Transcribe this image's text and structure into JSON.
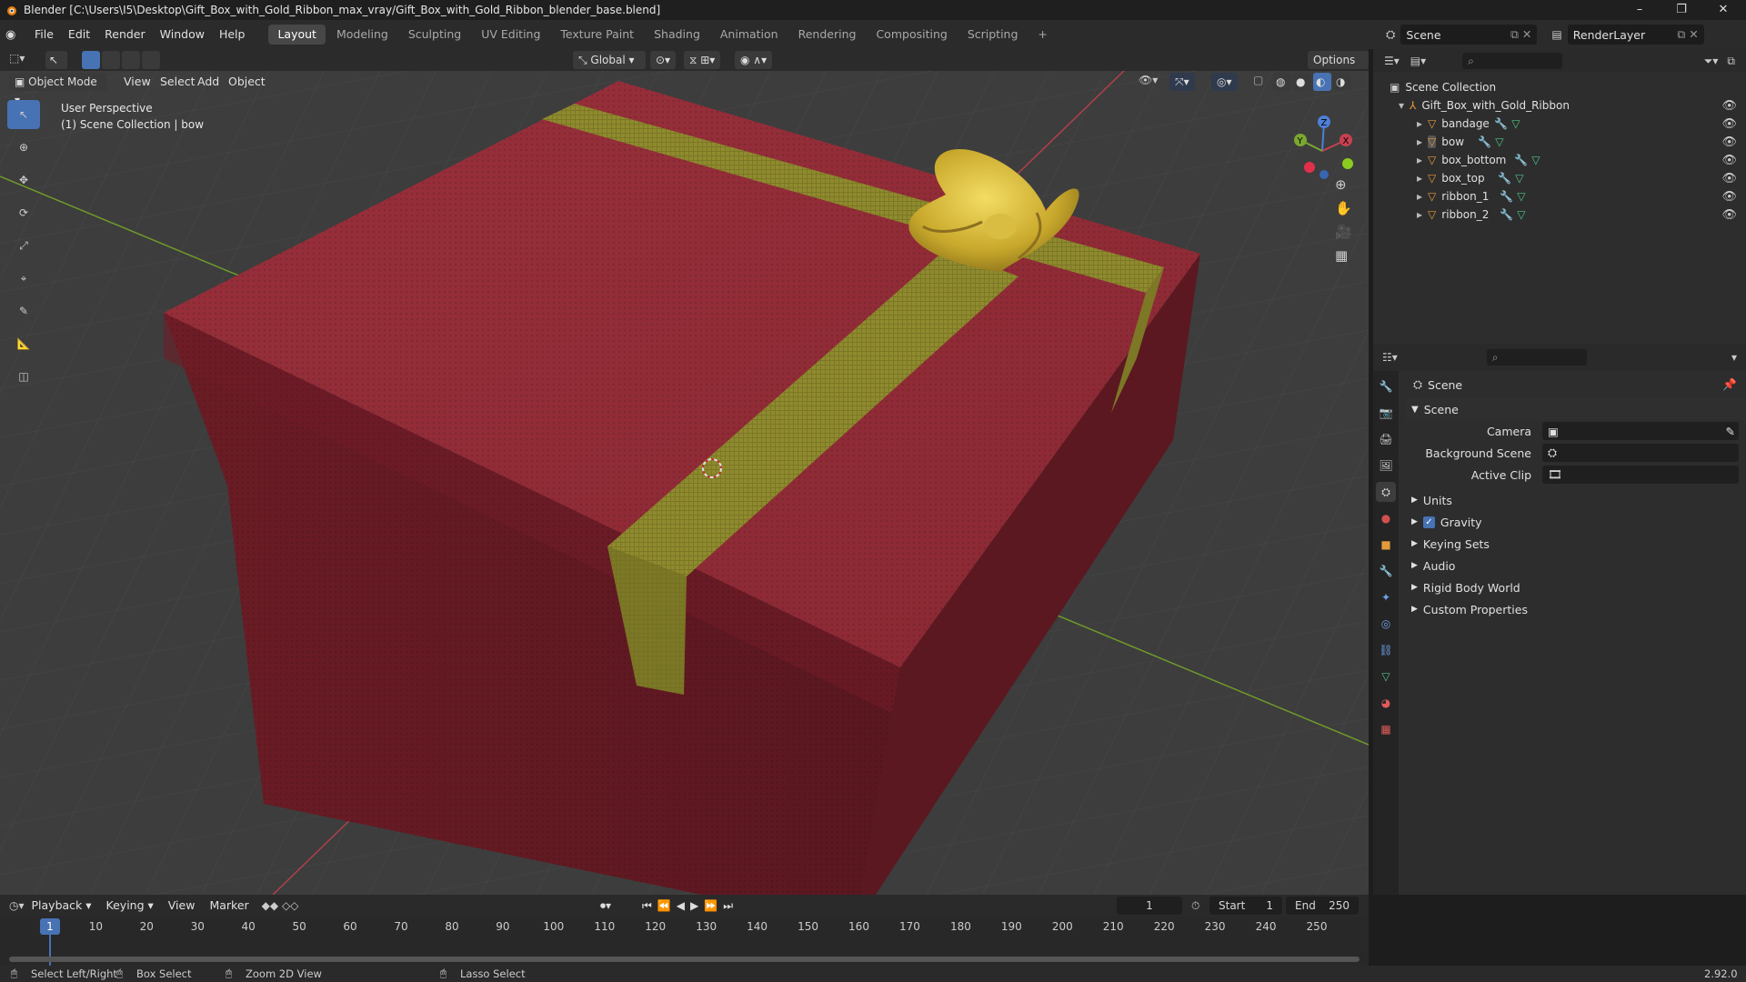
{
  "window": {
    "title": "Blender [C:\\Users\\I5\\Desktop\\Gift_Box_with_Gold_Ribbon_max_vray/Gift_Box_with_Gold_Ribbon_blender_base.blend]",
    "minimize": "–",
    "maximize": "❐",
    "close": "✕"
  },
  "menus": [
    "File",
    "Edit",
    "Render",
    "Window",
    "Help"
  ],
  "workspaces": [
    "Layout",
    "Modeling",
    "Sculpting",
    "UV Editing",
    "Texture Paint",
    "Shading",
    "Animation",
    "Rendering",
    "Compositing",
    "Scripting"
  ],
  "active_workspace": "Layout",
  "add_workspace": "+",
  "scene_selector": {
    "value": "Scene"
  },
  "renderlayer_selector": {
    "value": "RenderLayer"
  },
  "viewport_header": {
    "transform_orientation": "Global",
    "options": "Options",
    "mode": "Object Mode",
    "menus": [
      "View",
      "Select",
      "Add",
      "Object"
    ]
  },
  "viewport_overlay": {
    "line1": "User Perspective",
    "line2": "(1) Scene Collection | bow"
  },
  "gizmo": {
    "x": "X",
    "y": "Y",
    "z": "Z"
  },
  "outliner": {
    "root": "Scene Collection",
    "collection": "Gift_Box_with_Gold_Ribbon",
    "objects": [
      "bandage",
      "bow",
      "box_bottom",
      "box_top",
      "ribbon_1",
      "ribbon_2"
    ]
  },
  "properties": {
    "header": "Scene",
    "panel": "Scene",
    "camera_label": "Camera",
    "background_scene_label": "Background Scene",
    "active_clip_label": "Active Clip",
    "sections": [
      "Units",
      "Gravity",
      "Keying Sets",
      "Audio",
      "Rigid Body World",
      "Custom Properties"
    ],
    "gravity_checked": true
  },
  "timeline": {
    "menus": [
      "Playback",
      "Keying",
      "View",
      "Marker"
    ],
    "current_frame": "1",
    "start_label": "Start",
    "start": "1",
    "end_label": "End",
    "end": "250",
    "ticks": [
      "1",
      "10",
      "20",
      "30",
      "40",
      "50",
      "60",
      "70",
      "80",
      "90",
      "100",
      "110",
      "120",
      "130",
      "140",
      "150",
      "160",
      "170",
      "180",
      "190",
      "200",
      "210",
      "220",
      "230",
      "240",
      "250"
    ]
  },
  "statusbar": {
    "hint1": "Select Left/Right",
    "hint2": "Box Select",
    "hint3": "Zoom 2D View",
    "hint4": "Lasso Select",
    "version": "2.92.0"
  },
  "colors": {
    "accent": "#4772b3",
    "box_red": "#8e2a35",
    "ribbon_gold": "#8f8a2e",
    "bow_gold": "#c9a92c",
    "grid_x": "#b0404a",
    "grid_y": "#6f9a2a"
  }
}
